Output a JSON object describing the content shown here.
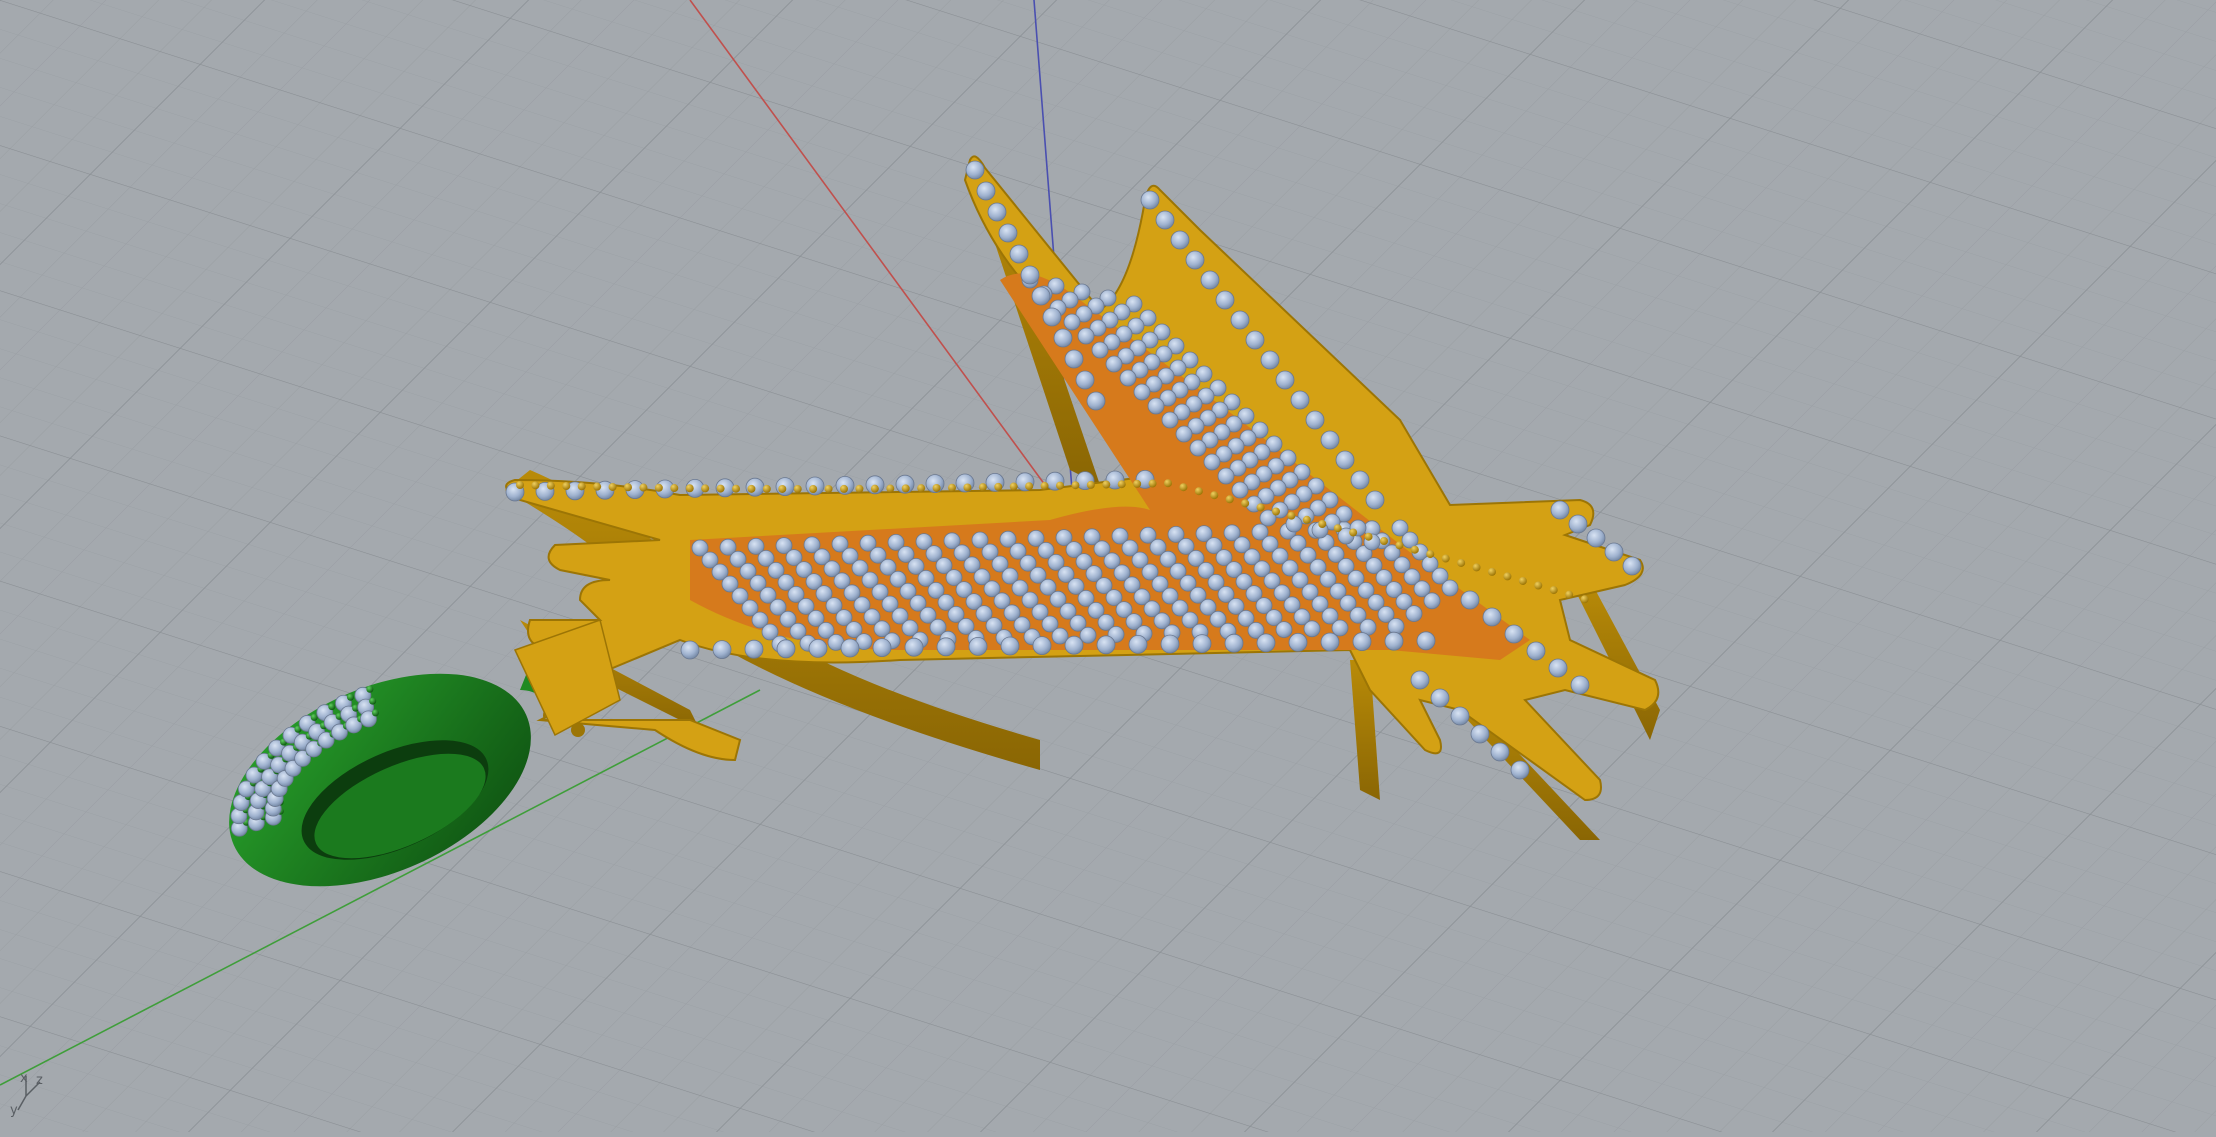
{
  "viewport": {
    "background": "#a4a9ae",
    "grid": {
      "minor_color": "#9ba0a5",
      "major_color": "#8c9196",
      "enabled": true
    },
    "axes": {
      "x_color": "#c0504d",
      "y_color": "#3f9e3a",
      "z_color": "#4a4fb0"
    },
    "axis_widget": {
      "x": "x",
      "y": "y",
      "z": "z"
    }
  },
  "model": {
    "pendant_color": "#d4a114",
    "pendant_shadow": "#9c7505",
    "pave_bed_color": "#d67a1c",
    "stone_color": "#9fb2cf",
    "prong_color": "#c49a1a",
    "bail_color": "#1f8a22",
    "bail_shadow": "#0e5812"
  }
}
